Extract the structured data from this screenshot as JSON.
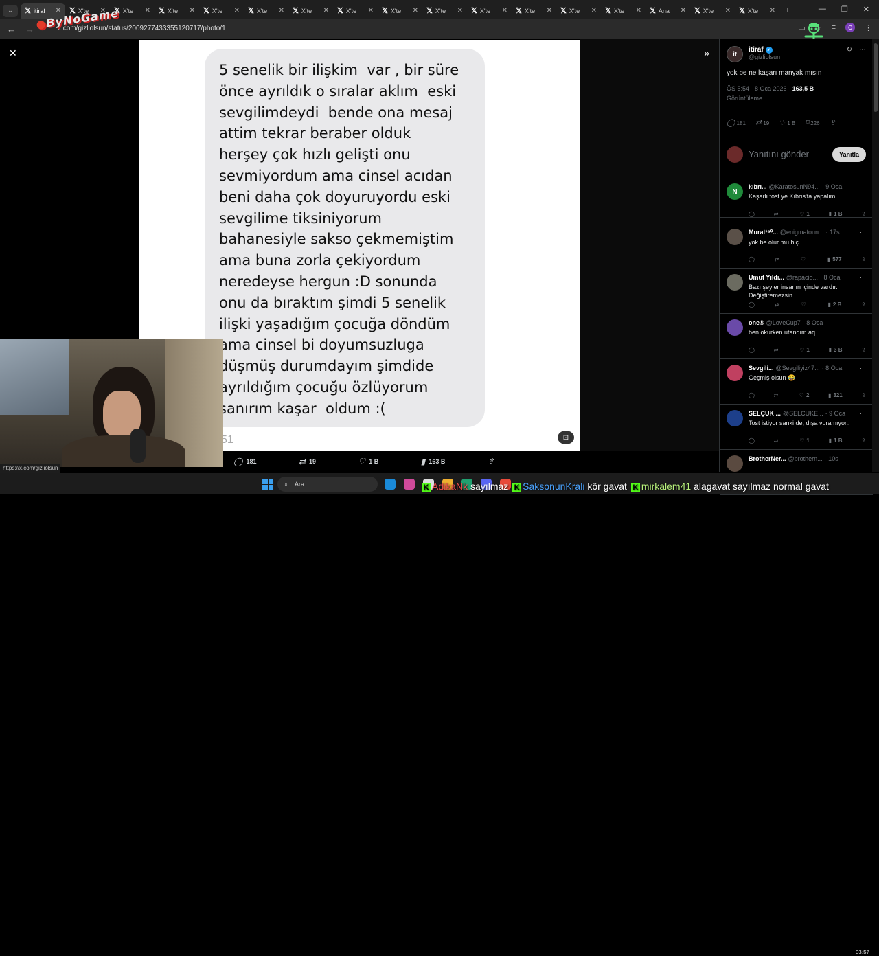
{
  "browser": {
    "tabs": [
      {
        "label": "itiraf",
        "active": true
      },
      {
        "label": "X'te"
      },
      {
        "label": "X'te"
      },
      {
        "label": "X'te"
      },
      {
        "label": "X'te"
      },
      {
        "label": "X'te"
      },
      {
        "label": "X'te"
      },
      {
        "label": "X'te"
      },
      {
        "label": "X'te"
      },
      {
        "label": "X'te"
      },
      {
        "label": "X'te"
      },
      {
        "label": "X'te"
      },
      {
        "label": "X'te"
      },
      {
        "label": "X'te"
      },
      {
        "label": "Ana"
      },
      {
        "label": "X'te"
      },
      {
        "label": "X'te"
      }
    ],
    "url": "x.com/gizliolsun/status/2009277433355120717/photo/1",
    "profile_initial": "C"
  },
  "overlay": {
    "logo": "ByNoGame"
  },
  "photo": {
    "lines": [
      "5 senelik bir ilişkim  var , bir süre",
      "önce ayrıldık o sıralar aklım  eski",
      "sevgilimdeydi  bende ona mesaj",
      "attim tekrar beraber olduk",
      "herşey çok hızlı gelişti onu",
      "sevmiyordum ama cinsel acıdan",
      "beni daha çok doyuruyordu eski",
      "sevgilime tiksiniyorum",
      "bahanesiyle sakso çekmemiştim",
      "ama buna zorla çekiyordum",
      "neredeyse hergun :D sonunda",
      "onu da bıraktım şimdi 5 senelik",
      "ilişki yaşadığım çocuğa döndüm",
      "ama cinsel bi doyumsuzluga",
      "düşmüş durumdayım şimdide",
      "ayrıldığım çocuğu özlüyorum",
      "sanırım kaşar  oldum :("
    ],
    "page_number": "51"
  },
  "photo_actions": {
    "replies": "181",
    "reposts": "19",
    "likes": "1 B",
    "views": "163 B"
  },
  "status_link": "https://x.com/gizliolsun",
  "post": {
    "name": "itiraf",
    "handle": "@gizliolsun",
    "text": "yok be ne kaşarı manyak mısın",
    "time": "ÖS 5:54 · 8 Oca 2026 ·",
    "views_count": "163,5 B",
    "views_label": "Görüntüleme",
    "stats": {
      "replies": "181",
      "reposts": "19",
      "likes": "1 B",
      "bookmarks": "226"
    }
  },
  "reply_box": {
    "placeholder": "Yanıtını gönder",
    "button": "Yanıtla"
  },
  "replies": [
    {
      "name": "kıbrı...",
      "handle": "@KaratosunN94...",
      "date": "· 9 Oca",
      "text": "Kaşarlı tost ye Kıbrıs'ta yapalım",
      "initial": "N",
      "color": "#1f8a3a",
      "reposts": "",
      "likes": "1",
      "views": "1 B"
    },
    {
      "name": "Murat¹⁹⁰...",
      "handle": "@enigmafoun...",
      "date": "· 17s",
      "text": "yok be olur mu hiç",
      "initial": "",
      "color": "#5a5048",
      "reposts": "",
      "likes": "",
      "views": "577"
    },
    {
      "name": "Umut Yıldı...",
      "handle": "@rapacio...",
      "date": "· 8 Oca",
      "text": "Bazı şeyler insanın içinde vardır. Değiştiremezsin...",
      "initial": "",
      "color": "#6b6b60",
      "reposts": "",
      "likes": "",
      "views": "2 B"
    },
    {
      "name": "one®",
      "handle": "@LoveCup7",
      "date": "· 8 Oca",
      "text": "ben okurken utandım aq",
      "initial": "",
      "color": "#6a4aa8",
      "reposts": "",
      "likes": "1",
      "views": "3 B"
    },
    {
      "name": "Sevgili...",
      "handle": "@Sevgiliyiz47...",
      "date": "· 8 Oca",
      "text": "Geçmiş olsun 😂",
      "initial": "",
      "color": "#c04060",
      "reposts": "",
      "likes": "2",
      "views": "321"
    },
    {
      "name": "SELÇUK ...",
      "handle": "@SELCUKE...",
      "date": "· 9 Oca",
      "text": "Tost istiyor sanki de, dışa vuramıyor..",
      "initial": "",
      "color": "#1d3f8a",
      "reposts": "",
      "likes": "1",
      "views": "1 B"
    },
    {
      "name": "BrotherNer...",
      "handle": "@brothern...",
      "date": "· 10s",
      "text": "",
      "initial": "",
      "color": "#5a4a40",
      "reposts": "",
      "likes": "",
      "views": ""
    }
  ],
  "taskbar": {
    "search_placeholder": "Ara",
    "time": "03:57"
  },
  "chat_ticker": {
    "u1": "AdikaNk",
    "m1": "sayılmaz",
    "u2": "SaksonunKrali",
    "m2": "kör gavat",
    "u3": "mirkalem41",
    "m3": "alagavat sayılmaz normal gavat"
  },
  "colors": {
    "accent": "#1d9bf0",
    "kick_green": "#53fc18"
  }
}
